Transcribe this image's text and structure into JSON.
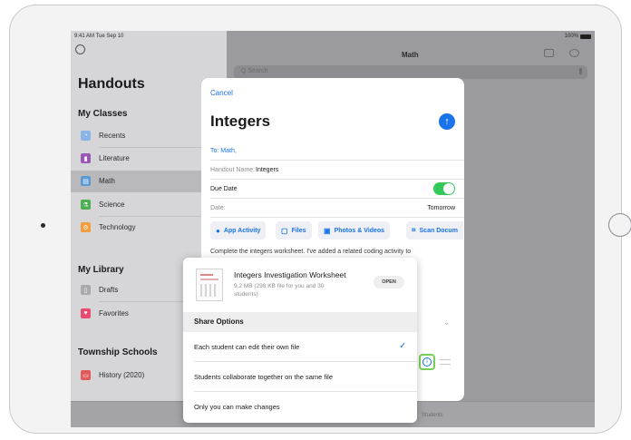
{
  "status_bar": {
    "time": "9:41 AM  Tue Sep 10",
    "battery": "100%"
  },
  "sidebar": {
    "title": "Handouts",
    "classes_header": "My Classes",
    "classes": [
      {
        "label": "Recents",
        "icon": "clock-icon",
        "color": "#8ab4e8"
      },
      {
        "label": "Literature",
        "icon": "book-icon",
        "color": "#9b59b6"
      },
      {
        "label": "Math",
        "icon": "math-book-icon",
        "color": "#5a9bd6",
        "selected": true
      },
      {
        "label": "Science",
        "icon": "science-icon",
        "color": "#4caf50"
      },
      {
        "label": "Technology",
        "icon": "technology-icon",
        "color": "#f39c3c"
      }
    ],
    "library_header": "My Library",
    "library": [
      {
        "label": "Drafts",
        "icon": "drafts-icon",
        "color": "#a8a8ad"
      },
      {
        "label": "Favorites",
        "icon": "heart-icon",
        "color": "#e84a6f"
      }
    ],
    "schools_header": "Township Schools",
    "schools": [
      {
        "label": "History (2020)",
        "icon": "history-icon",
        "color": "#e05a5a"
      }
    ]
  },
  "main": {
    "title": "Math",
    "search_placeholder": "Q Search",
    "tab_students": "Students"
  },
  "modal": {
    "cancel": "Cancel",
    "title": "Integers",
    "to_label": "To: Math,",
    "handout_name_label": "Handout Name:",
    "handout_name_value": "Integers",
    "due_date_label": "Due Date",
    "date_label": "Date:",
    "date_value": "Tomorrow",
    "chips": [
      {
        "label": "App Activity",
        "icon": "app-activity-icon"
      },
      {
        "label": "Files",
        "icon": "files-icon"
      },
      {
        "label": "Photos & Videos",
        "icon": "photos-icon"
      },
      {
        "label": "Scan Docum",
        "icon": "scan-icon"
      }
    ],
    "note": "Complete the integers worksheet. I've added a related coding activity to"
  },
  "popover": {
    "file_name": "Integers Investigation Worksheet",
    "file_meta": "9.2 MB (298 KB file for you and 30 students)",
    "open": "OPEN",
    "share_header": "Share Options",
    "options": [
      {
        "label": "Each student can edit their own file",
        "selected": true
      },
      {
        "label": "Students collaborate together on the same file",
        "selected": false
      },
      {
        "label": "Only you can make changes",
        "selected": false
      }
    ]
  },
  "colors": {
    "accent": "#1a73e8",
    "toggle_on": "#34c759",
    "highlight": "#78d05c"
  }
}
